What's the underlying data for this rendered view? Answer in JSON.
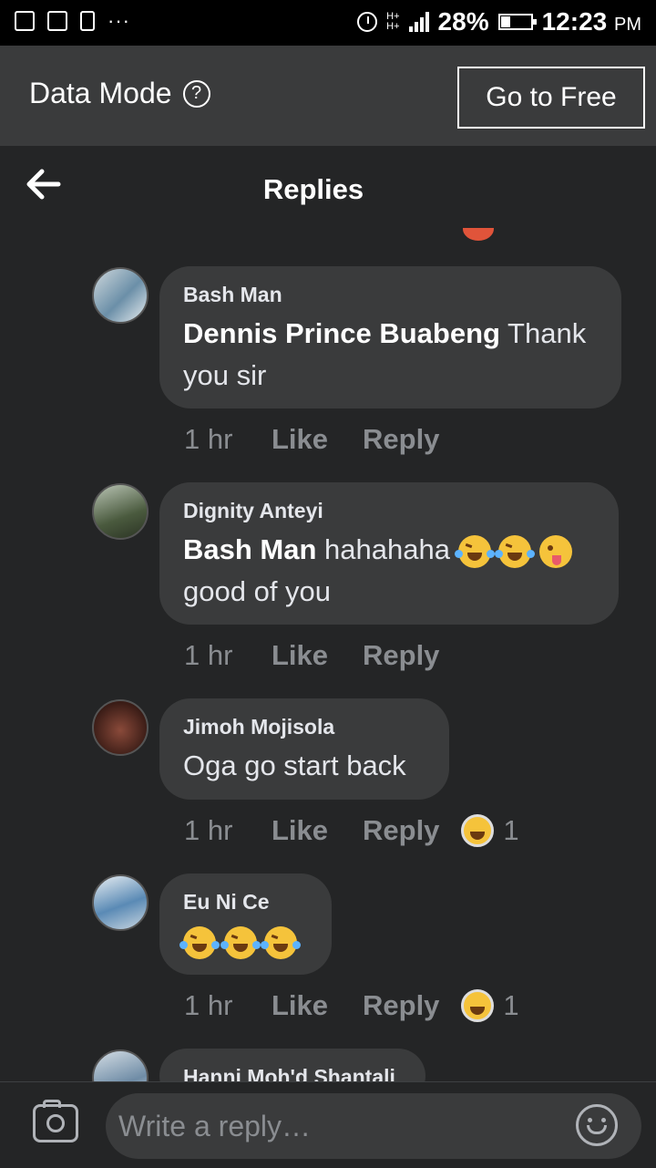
{
  "status_bar": {
    "battery": "28%",
    "time": "12:23",
    "ampm": "PM",
    "network": "H+"
  },
  "data_mode": {
    "label": "Data Mode",
    "help_icon": "?",
    "button": "Go to Free"
  },
  "header": {
    "title": "Replies"
  },
  "comments": [
    {
      "author": "Bash Man",
      "mention": "Dennis Prince Buabeng",
      "text": "Thank you sir",
      "time": "1 hr",
      "like": "Like",
      "reply": "Reply",
      "reactions": null
    },
    {
      "author": "Dignity Anteyi",
      "mention": "Bash Man",
      "text": "hahahaha",
      "text2": "good of you",
      "time": "1 hr",
      "like": "Like",
      "reply": "Reply",
      "reactions": null
    },
    {
      "author": "Jimoh Mojisola",
      "mention": "",
      "text": "Oga go start back",
      "time": "1 hr",
      "like": "Like",
      "reply": "Reply",
      "reactions": "1"
    },
    {
      "author": "Eu Ni Ce",
      "mention": "",
      "text": "",
      "time": "1 hr",
      "like": "Like",
      "reply": "Reply",
      "reactions": "1"
    },
    {
      "author": "Hanni Moh'd Shantali"
    }
  ],
  "composer": {
    "placeholder": "Write a reply…"
  },
  "colors": {
    "background": "#242526",
    "bubble": "#3a3b3c",
    "muted": "#8a8d91"
  }
}
